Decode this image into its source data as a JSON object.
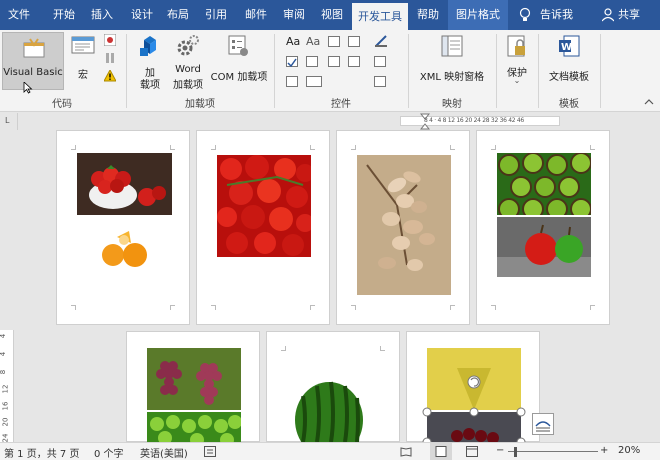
{
  "tabs": [
    {
      "label": "文件"
    },
    {
      "label": "开始"
    },
    {
      "label": "插入"
    },
    {
      "label": "设计"
    },
    {
      "label": "布局"
    },
    {
      "label": "引用"
    },
    {
      "label": "邮件"
    },
    {
      "label": "审阅"
    },
    {
      "label": "视图"
    },
    {
      "label": "开发工具"
    },
    {
      "label": "帮助"
    },
    {
      "label": "图片格式"
    }
  ],
  "tell_me": "告诉我",
  "share": "共享",
  "ribbon": {
    "code": {
      "label": "代码",
      "visual_basic": "Visual Basic",
      "macro": "宏"
    },
    "addins": {
      "label": "加载项",
      "addin_line1": "加",
      "addin_line2": "载项",
      "word_line1": "Word",
      "word_line2": "加载项",
      "com": "COM 加载项"
    },
    "controls": {
      "label": "控件"
    },
    "mapping": {
      "label": "映射",
      "xml": "XML 映射窗格"
    },
    "protect": {
      "label": "保护"
    },
    "templates": {
      "label": "模板",
      "doc_template": "文档模板"
    }
  },
  "ruler": {
    "numbers": "8  4  ·  4  8  12 16 20 24 28 32 36  42 46",
    "corner": "L",
    "vertical": [
      "4",
      "4",
      "8",
      "12",
      "16",
      "20",
      "24"
    ]
  },
  "status": {
    "page": "第 1 页，共 7 页",
    "words": "0 个字",
    "lang": "英语(美国)",
    "zoom": "20%"
  },
  "colors": {
    "accent": "#2b579a",
    "ribbon_bg": "#f3f3f3",
    "canvas": "#e6e6e6"
  }
}
